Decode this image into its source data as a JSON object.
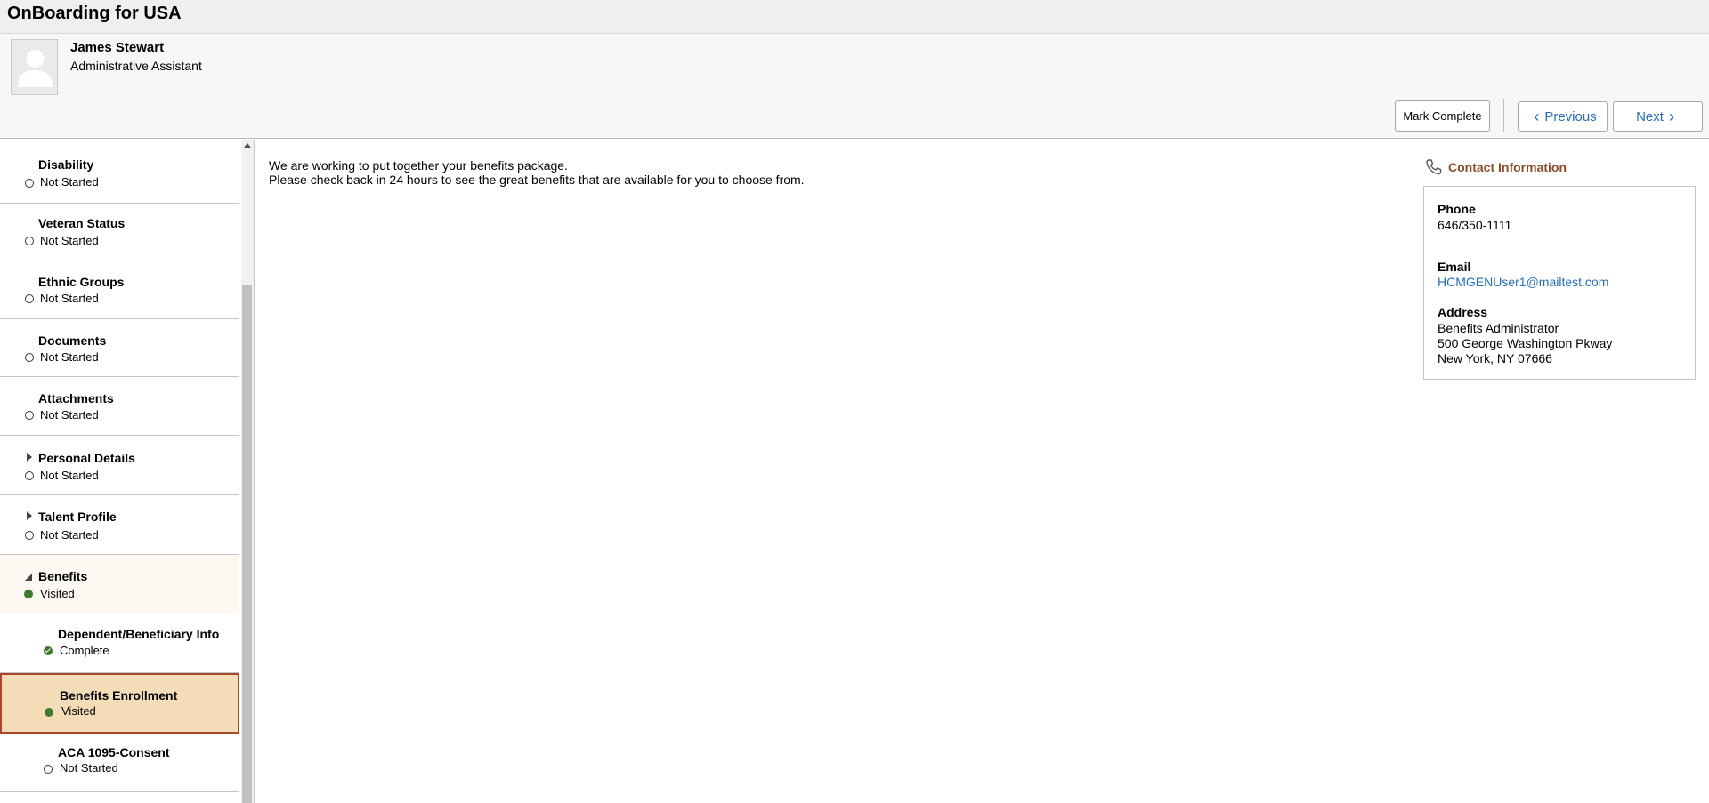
{
  "app": {
    "title": "OnBoarding for USA"
  },
  "employee": {
    "name": "James Stewart",
    "job_title": "Administrative Assistant"
  },
  "toolbar": {
    "mark_complete": "Mark Complete",
    "previous": "Previous",
    "next": "Next"
  },
  "nav": {
    "items": [
      {
        "label": "Disability",
        "status": "Not Started"
      },
      {
        "label": "Veteran Status",
        "status": "Not Started"
      },
      {
        "label": "Ethnic Groups",
        "status": "Not Started"
      },
      {
        "label": "Documents",
        "status": "Not Started"
      },
      {
        "label": "Attachments",
        "status": "Not Started"
      },
      {
        "label": "Personal Details",
        "status": "Not Started"
      },
      {
        "label": "Talent Profile",
        "status": "Not Started"
      },
      {
        "label": "Benefits",
        "status": "Visited"
      },
      {
        "label": "Dependent/Beneficiary Info",
        "status": "Complete"
      },
      {
        "label": "Benefits Enrollment",
        "status": "Visited"
      },
      {
        "label": "ACA 1095-Consent",
        "status": "Not Started"
      }
    ]
  },
  "main": {
    "line1": "We are working to put together your benefits package.",
    "line2": "Please check back in 24 hours to see the great benefits that are available for you to choose from."
  },
  "contact": {
    "heading": "Contact Information",
    "phone_label": "Phone",
    "phone": "646/350-1111",
    "email_label": "Email",
    "email": "HCMGENUser1@mailtest.com",
    "address_label": "Address",
    "address_line1": "Benefits Administrator",
    "address_line2": "500 George Washington Pkway",
    "address_line3": "New York, NY 07666"
  },
  "colors": {
    "accent_link": "#2a6db2",
    "status_green": "#3d7a2e",
    "active_bg": "#f5dcb9",
    "active_border": "#a8492f",
    "contact_heading": "#8a4d2a"
  }
}
